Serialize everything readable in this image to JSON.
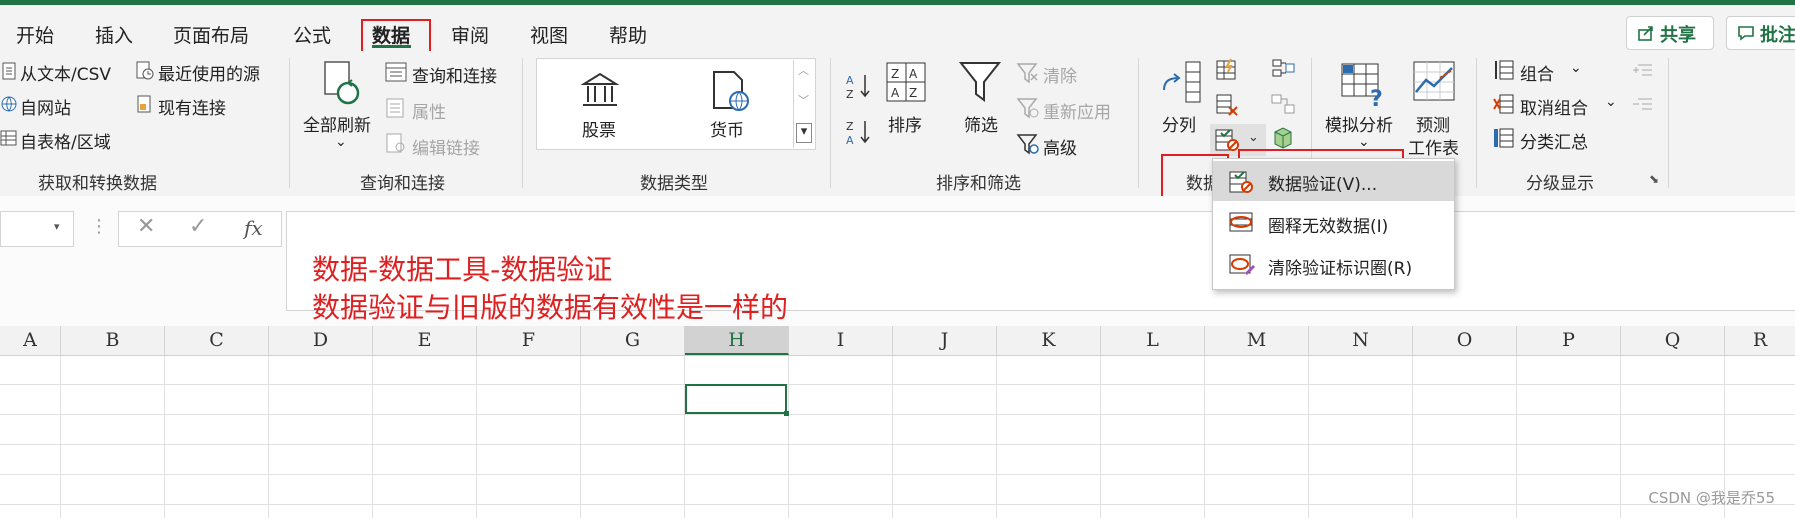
{
  "tabs": [
    "开始",
    "插入",
    "页面布局",
    "公式",
    "数据",
    "审阅",
    "视图",
    "帮助"
  ],
  "share_label": "共享",
  "comments_label": "批注",
  "groups": {
    "get_transform": {
      "label": "获取和转换数据",
      "items": [
        "从文本/CSV",
        "最近使用的源",
        "自网站",
        "现有连接",
        "自表格/区域"
      ]
    },
    "queries": {
      "label": "查询和连接",
      "refresh_all": "全部刷新",
      "items": [
        "查询和连接",
        "属性",
        "编辑链接"
      ]
    },
    "data_types": {
      "label": "数据类型",
      "items": [
        "股票",
        "货币"
      ]
    },
    "sort_filter": {
      "label": "排序和筛选",
      "sort": "排序",
      "filter": "筛选",
      "clear": "清除",
      "reapply": "重新应用",
      "advanced": "高级"
    },
    "data_tools": {
      "label": "数据",
      "split": "分列"
    },
    "forecast": {
      "what_if": "模拟分析",
      "forecast_sheet_line1": "预测",
      "forecast_sheet_line2": "工作表"
    },
    "outline": {
      "label": "分级显示",
      "items": [
        "组合",
        "取消组合",
        "分类汇总"
      ]
    }
  },
  "dropdown": {
    "items": [
      "数据验证(V)...",
      "圈释无效数据(I)",
      "清除验证标识圈(R)"
    ]
  },
  "formula_bar": {
    "fx": "fx",
    "annotation_line1": "数据-数据工具-数据验证",
    "annotation_line2": "数据验证与旧版的数据有效性是一样的"
  },
  "columns": [
    "A",
    "B",
    "C",
    "D",
    "E",
    "F",
    "G",
    "H",
    "I",
    "J",
    "K",
    "L",
    "M",
    "N",
    "O",
    "P",
    "Q",
    "R"
  ],
  "selected_column": "H",
  "watermark": "CSDN @我是乔55",
  "colors": {
    "excel_green": "#217346",
    "annotation_red": "#e02020"
  }
}
